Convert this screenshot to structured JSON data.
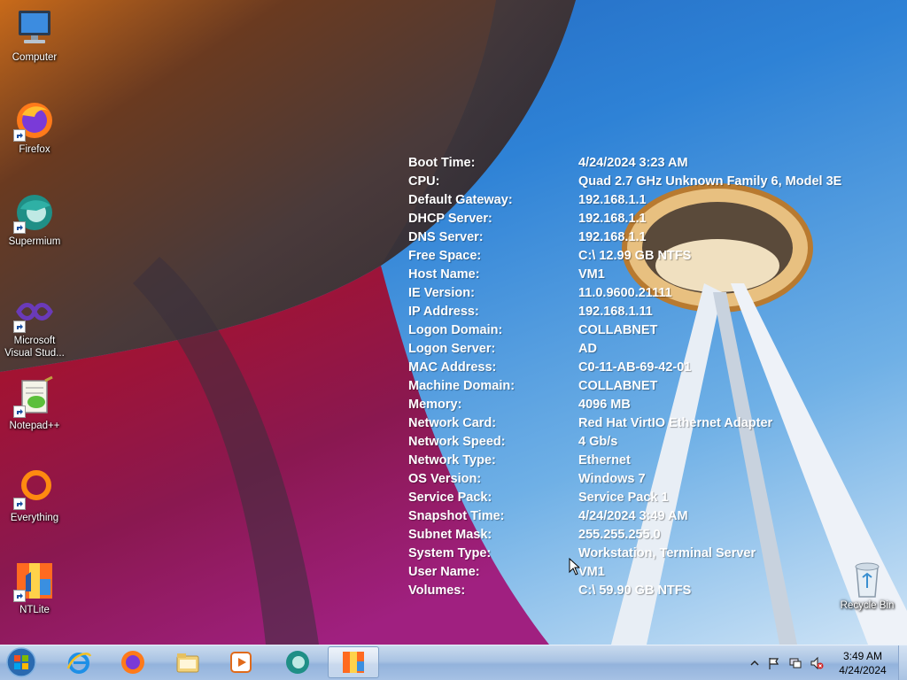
{
  "desktop_icons": [
    {
      "label": "Computer",
      "icon": "computer-icon",
      "shortcut": false
    },
    {
      "label": "Firefox",
      "icon": "firefox-icon",
      "shortcut": true
    },
    {
      "label": "Supermium",
      "icon": "supermium-icon",
      "shortcut": true
    },
    {
      "label": "Microsoft\nVisual Stud...",
      "icon": "visual-studio-icon",
      "shortcut": true
    },
    {
      "label": "Notepad++",
      "icon": "notepadpp-icon",
      "shortcut": true
    },
    {
      "label": "Everything",
      "icon": "everything-icon",
      "shortcut": true
    },
    {
      "label": "NTLite",
      "icon": "ntlite-icon",
      "shortcut": true
    }
  ],
  "bginfo": [
    {
      "key": "Boot Time:",
      "value": "4/24/2024 3:23 AM"
    },
    {
      "key": "CPU:",
      "value": "Quad 2.7 GHz Unknown Family 6, Model 3E"
    },
    {
      "key": "Default Gateway:",
      "value": "192.168.1.1"
    },
    {
      "key": "DHCP Server:",
      "value": "192.168.1.1"
    },
    {
      "key": "DNS Server:",
      "value": "192.168.1.1"
    },
    {
      "key": "Free Space:",
      "value": "C:\\ 12.99 GB NTFS"
    },
    {
      "key": "Host Name:",
      "value": "VM1"
    },
    {
      "key": "IE Version:",
      "value": "11.0.9600.21111"
    },
    {
      "key": "IP Address:",
      "value": "192.168.1.11"
    },
    {
      "key": "Logon Domain:",
      "value": "COLLABNET"
    },
    {
      "key": "Logon Server:",
      "value": "AD"
    },
    {
      "key": "MAC Address:",
      "value": "C0-11-AB-69-42-01"
    },
    {
      "key": "Machine Domain:",
      "value": "COLLABNET"
    },
    {
      "key": "Memory:",
      "value": "4096 MB"
    },
    {
      "key": "Network Card:",
      "value": "Red Hat VirtIO Ethernet Adapter"
    },
    {
      "key": "Network Speed:",
      "value": "4 Gb/s"
    },
    {
      "key": "Network Type:",
      "value": "Ethernet"
    },
    {
      "key": "OS Version:",
      "value": "Windows 7"
    },
    {
      "key": "Service Pack:",
      "value": "Service Pack 1"
    },
    {
      "key": "Snapshot Time:",
      "value": "4/24/2024 3:49 AM"
    },
    {
      "key": "Subnet Mask:",
      "value": "255.255.255.0"
    },
    {
      "key": "System Type:",
      "value": "Workstation, Terminal Server"
    },
    {
      "key": "User Name:",
      "value": "VM1"
    },
    {
      "key": "Volumes:",
      "value": "C:\\ 59.90 GB NTFS"
    }
  ],
  "recycle_bin": {
    "label": "Recycle Bin"
  },
  "taskbar": {
    "pinned": [
      {
        "icon": "internet-explorer-icon"
      },
      {
        "icon": "firefox-icon"
      },
      {
        "icon": "file-explorer-icon"
      },
      {
        "icon": "media-player-icon"
      },
      {
        "icon": "supermium-icon"
      },
      {
        "icon": "ntlite-icon",
        "active": true
      }
    ],
    "clock": {
      "time": "3:49 AM",
      "date": "4/24/2024"
    }
  }
}
